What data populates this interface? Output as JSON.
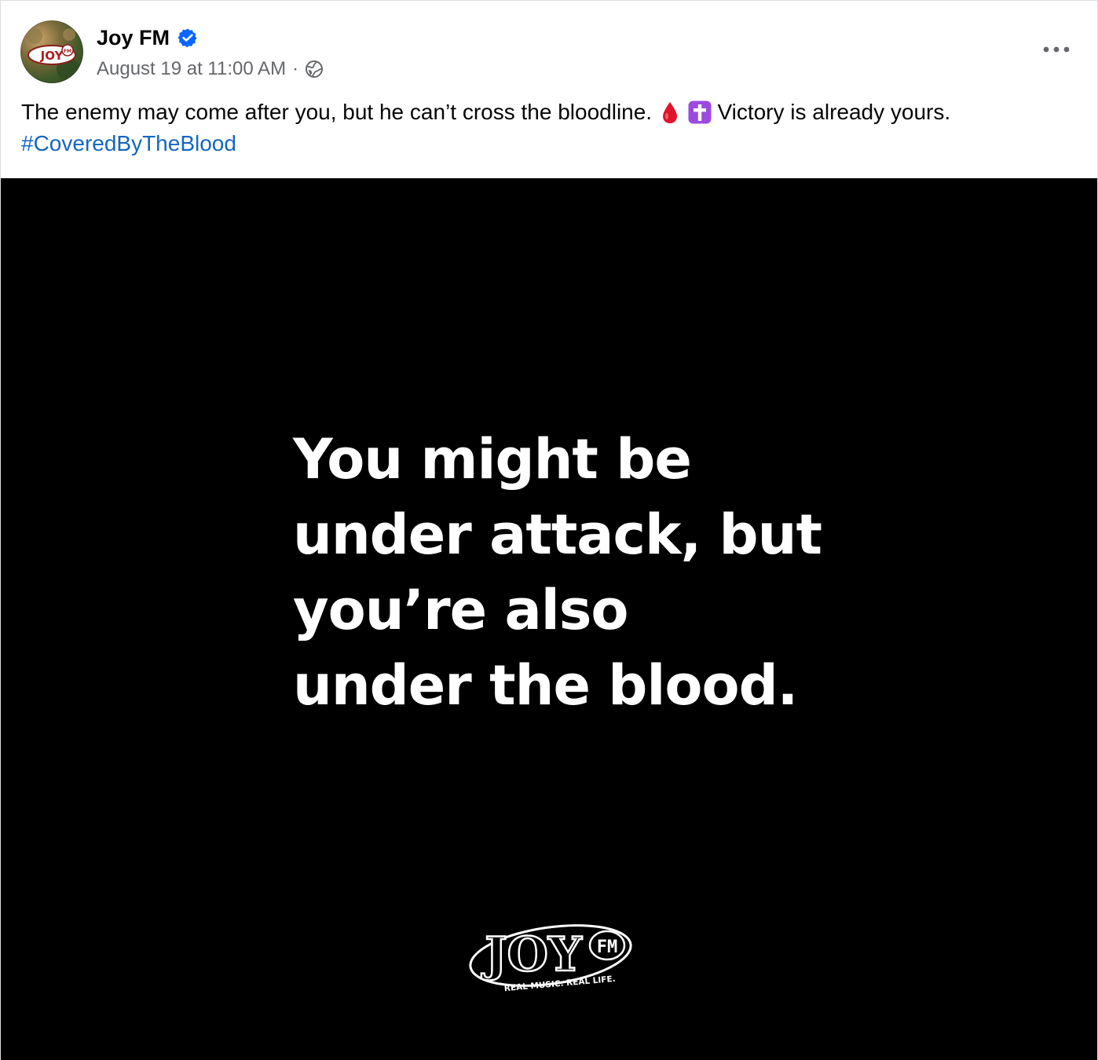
{
  "post": {
    "page_name": "Joy FM",
    "timestamp": "August 19 at 11:00 AM",
    "separator": "·",
    "avatar_icon": "joy-fm-logo-avatar",
    "verified_icon": "verified-badge-icon",
    "audience_icon": "globe-icon",
    "more_icon": "more-options-icon",
    "caption": {
      "text_before": "The enemy may come after you, but he can’t cross the bloodline.",
      "emoji_1": "drop-of-blood-emoji",
      "emoji_2": "latin-cross-emoji",
      "text_after": "Victory is already yours.",
      "hashtag": "#CoveredByTheBlood"
    },
    "image": {
      "quote_lines": [
        "You might be",
        "under attack, but",
        "you’re also",
        "under the blood."
      ],
      "logo_text": "JOY",
      "logo_badge": "FM",
      "logo_tagline": "REAL MUSIC. REAL LIFE.",
      "background_color": "#000000"
    }
  },
  "colors": {
    "verified_blue": "#0866ff",
    "hashtag_blue": "#1467c0",
    "meta_gray": "#65676b"
  }
}
